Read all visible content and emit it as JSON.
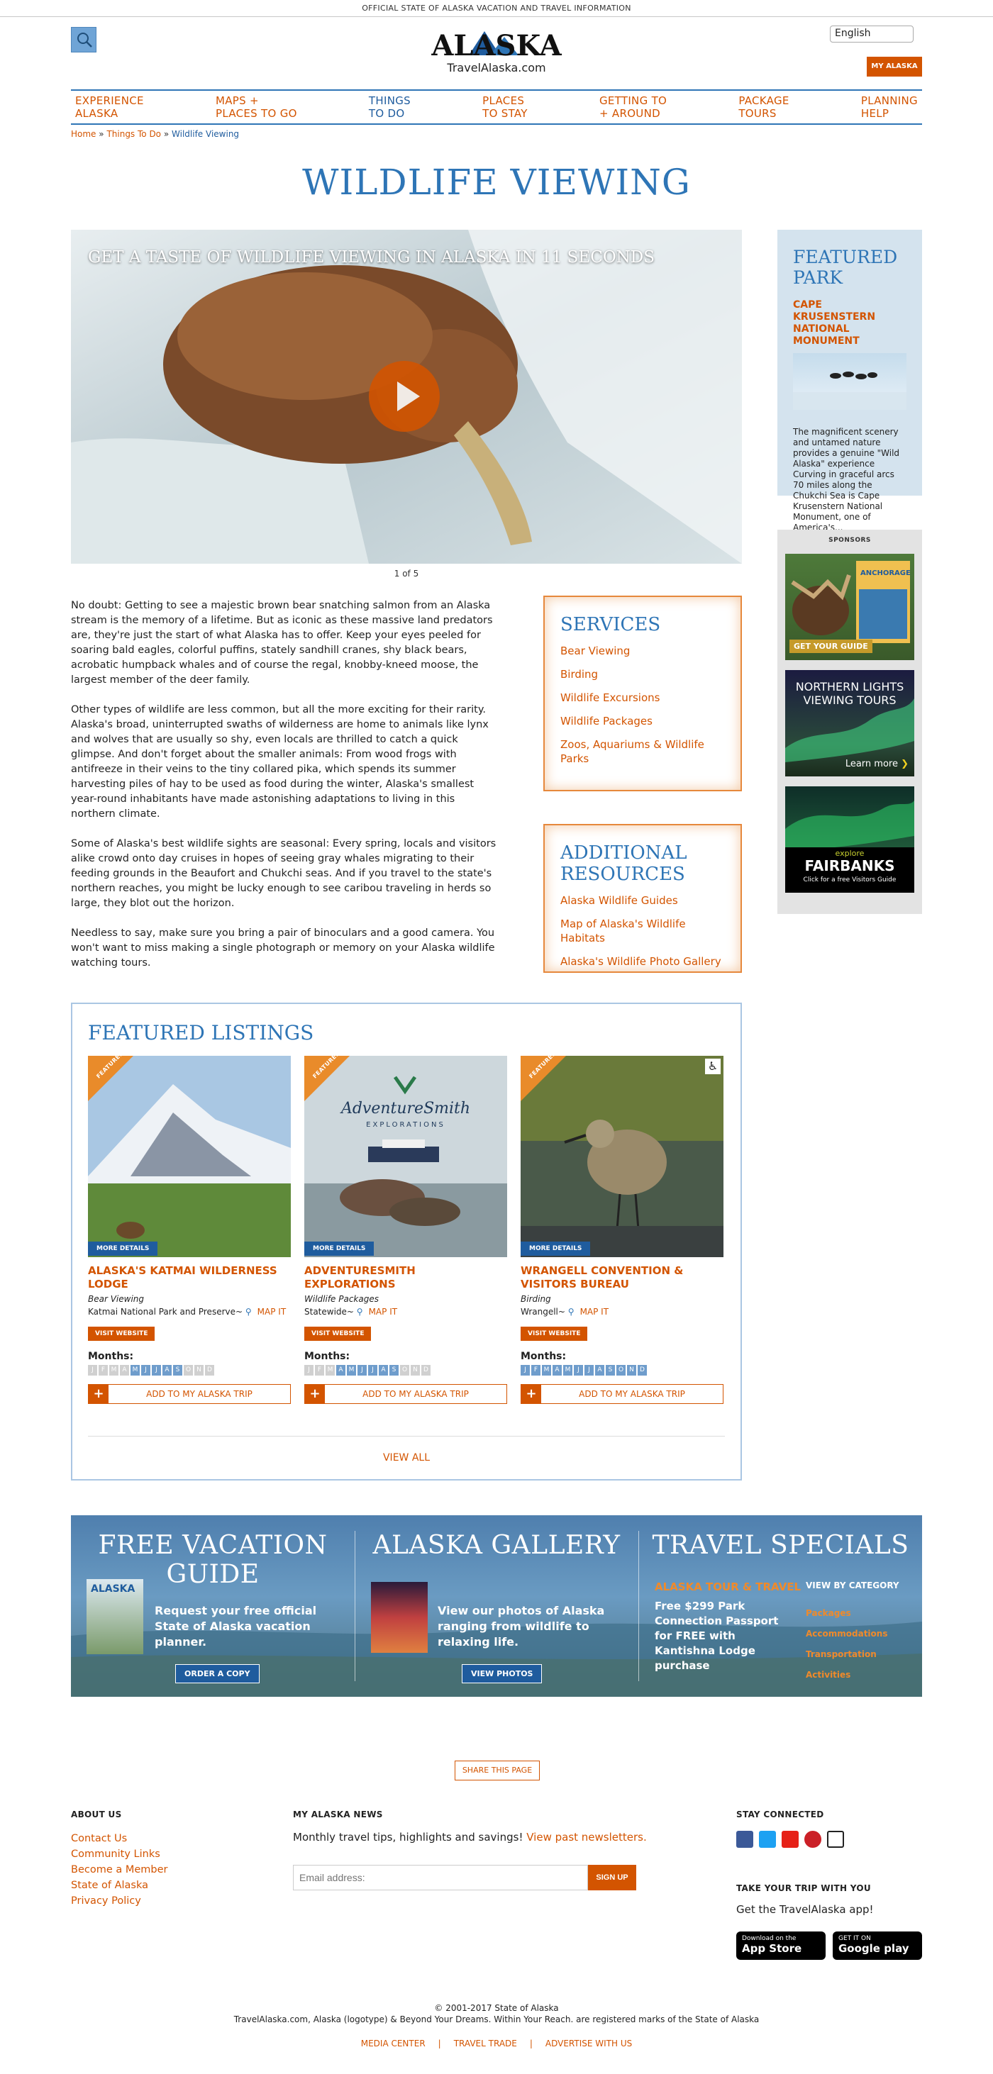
{
  "top_bar": {
    "text": "OFFICIAL STATE OF ALASKA VACATION AND TRAVEL INFORMATION"
  },
  "header": {
    "logo_text": "ALASKA",
    "logo_sub": "TravelAlaska.com",
    "language": "English",
    "my_alaska": "MY ALASKA"
  },
  "nav": [
    {
      "l1": "EXPERIENCE",
      "l2": "ALASKA"
    },
    {
      "l1": "MAPS +",
      "l2": "PLACES TO GO"
    },
    {
      "l1": "THINGS",
      "l2": "TO DO"
    },
    {
      "l1": "PLACES",
      "l2": "TO STAY"
    },
    {
      "l1": "GETTING TO",
      "l2": "+ AROUND"
    },
    {
      "l1": "PACKAGE",
      "l2": "TOURS"
    },
    {
      "l1": "PLANNING",
      "l2": "HELP"
    }
  ],
  "breadcrumbs": [
    "Home",
    "»",
    "Things To Do",
    "»",
    "Wildlife Viewing"
  ],
  "page_title": "WILDLIFE VIEWING",
  "hero": {
    "caption": "GET A TASTE OF WILDLIFE VIEWING IN ALASKA IN 11 SECONDS",
    "slide_count": "1 of 5"
  },
  "body_paragraphs": [
    "No doubt: Getting to see a majestic brown bear snatching salmon from an Alaska stream is the memory of a lifetime. But as iconic as these massive land predators are, they're just the start of what Alaska has to offer. Keep your eyes peeled for soaring bald eagles, colorful puffins, stately sandhill cranes, shy black bears, acrobatic humpback whales and of course the regal, knobby-kneed moose, the largest member of the deer family.",
    "Other types of wildlife are less common, but all the more exciting for their rarity. Alaska's broad, uninterrupted swaths of wilderness are home to animals like lynx and wolves that are usually so shy, even locals are thrilled to catch a quick glimpse. And don't forget about the smaller animals: From wood frogs with antifreeze in their veins to the tiny collared pika, which spends its summer harvesting piles of hay to be used as food during the winter, Alaska's smallest year-round inhabitants have made astonishing adaptations to living in this northern climate.",
    "Some of Alaska's best wildlife sights are seasonal: Every spring, locals and visitors alike crowd onto day cruises in hopes of seeing gray whales migrating to their feeding grounds in the Beaufort and Chukchi seas. And if you travel to the state's northern reaches, you might be lucky enough to see caribou traveling in herds so large, they blot out the horizon.",
    "Needless to say, make sure you bring a pair of binoculars and a good camera. You won't want to miss making a single photograph or memory on your Alaska wildlife watching tours."
  ],
  "services": {
    "title": "SERVICES",
    "links": [
      "Bear Viewing",
      "Birding",
      "Wildlife Excursions",
      "Wildlife Packages",
      "Zoos, Aquariums & Wildlife Parks"
    ]
  },
  "resources": {
    "title": "ADDITIONAL RESOURCES",
    "links": [
      "Alaska Wildlife Guides",
      "Map of Alaska's Wildlife Habitats",
      "Alaska's Wildlife Photo Gallery"
    ]
  },
  "featured_park": {
    "title": "FEATURED PARK",
    "name": "CAPE KRUSENSTERN NATIONAL MONUMENT",
    "desc": "The magnificent scenery and untamed nature provides a genuine \"Wild Alaska\" experience Curving in graceful arcs 70 miles along the Chukchi Sea is Cape Krusenstern National Monument, one of America's..."
  },
  "sponsors": {
    "title": "SPONSORS",
    "ad1_label": "GET YOUR GUIDE",
    "ad1_brand": "ANCHORAGE",
    "ad2_title": "NORTHERN LIGHTS VIEWING TOURS",
    "ad2_more": "Learn more",
    "ad3_brand": "explore",
    "ad3_city": "FAIRBANKS",
    "ad3_sub": "Click for a free Visitors Guide"
  },
  "featured_listings": {
    "title": "FEATURED LISTINGS",
    "ribbon": "FEATURED",
    "more_details": "MORE DETAILS",
    "visit_website": "VISIT WEBSITE",
    "months_label": "Months:",
    "add_trip": "ADD TO MY ALASKA TRIP",
    "map_it": "MAP IT",
    "view_all": "VIEW ALL",
    "month_letters": [
      "J",
      "F",
      "M",
      "A",
      "M",
      "J",
      "J",
      "A",
      "S",
      "O",
      "N",
      "D"
    ],
    "items": [
      {
        "title": "ALASKA'S KATMAI WILDERNESS LODGE",
        "category": "Bear Viewing",
        "location": "Katmai National Park and Preserve~",
        "months_on": [
          0,
          0,
          0,
          0,
          1,
          1,
          1,
          1,
          1,
          0,
          0,
          0
        ]
      },
      {
        "title": "ADVENTURESMITH EXPLORATIONS",
        "category": "Wildlife Packages",
        "location": "Statewide~",
        "brand": "AdventureSmith",
        "brand_sub": "EXPLORATIONS",
        "months_on": [
          0,
          0,
          0,
          1,
          1,
          1,
          1,
          1,
          1,
          0,
          0,
          0
        ]
      },
      {
        "title": "WRANGELL CONVENTION & VISITORS BUREAU",
        "category": "Birding",
        "location": "Wrangell~",
        "months_on": [
          1,
          1,
          1,
          1,
          1,
          1,
          1,
          1,
          1,
          1,
          1,
          1
        ]
      }
    ]
  },
  "banner": {
    "guide_title": "FREE VACATION GUIDE",
    "guide_brand": "ALASKA",
    "guide_text": "Request your free official State of Alaska vacation planner.",
    "guide_btn": "ORDER A COPY",
    "gallery_title": "ALASKA GALLERY",
    "gallery_text": "View our photos of Alaska ranging from wildlife to relaxing life.",
    "gallery_btn": "VIEW PHOTOS",
    "specials_title": "TRAVEL SPECIALS",
    "specials_sub": "ALASKA TOUR & TRAVEL",
    "specials_text": "Free $299 Park Connection Passport for FREE with Kantishna Lodge purchase",
    "category_label": "VIEW BY CATEGORY",
    "categories": [
      "Packages",
      "Accommodations",
      "Transportation",
      "Activities"
    ]
  },
  "share": "SHARE THIS PAGE",
  "footer": {
    "about_title": "ABOUT US",
    "about_links": [
      "Contact Us",
      "Community Links",
      "Become a Member",
      "State of Alaska",
      "Privacy Policy"
    ],
    "news_title": "MY ALASKA NEWS",
    "news_text": "Monthly travel tips, highlights and savings!",
    "news_link": "View past newsletters.",
    "email_placeholder": "Email address:",
    "signup": "SIGN UP",
    "stay_title": "STAY CONNECTED",
    "trip_title": "TAKE YOUR TRIP WITH YOU",
    "app_text": "Get the TravelAlaska app!",
    "appstore_small": "Download on the",
    "appstore_big": "App Store",
    "play_small": "GET IT ON",
    "play_big": "Google play",
    "copyright": "© 2001-2017 State of Alaska",
    "marks": "TravelAlaska.com, Alaska (logotype) & Beyond Your Dreams. Within Your Reach. are registered marks of the State of Alaska",
    "bottom_links": [
      "MEDIA CENTER",
      "TRAVEL TRADE",
      "ADVERTISE WITH US"
    ]
  },
  "colors": {
    "orange": "#d35400",
    "blue": "#2e75b6",
    "navy": "#1f5c9e"
  }
}
